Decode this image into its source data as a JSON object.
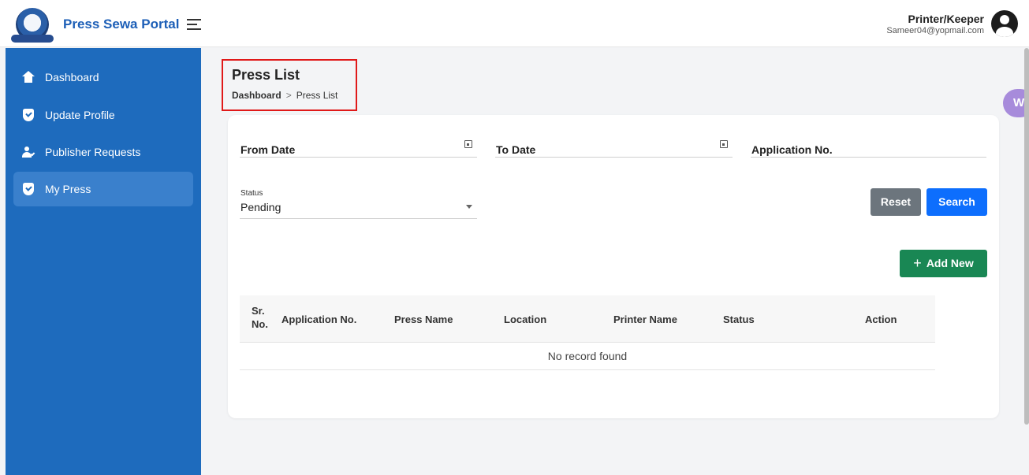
{
  "header": {
    "brand": "Press Sewa Portal",
    "user_role": "Printer/Keeper",
    "user_email": "Sameer04@yopmail.com"
  },
  "sidebar": {
    "items": [
      {
        "label": "Dashboard",
        "icon": "home-icon"
      },
      {
        "label": "Update Profile",
        "icon": "shield-check-icon"
      },
      {
        "label": "Publisher Requests",
        "icon": "user-check-icon"
      },
      {
        "label": "My Press",
        "icon": "shield-check-icon",
        "active": true
      }
    ]
  },
  "page": {
    "title": "Press List",
    "breadcrumb": {
      "home": "Dashboard",
      "separator": ">",
      "current": "Press List"
    }
  },
  "filters": {
    "from_date_label": "From Date",
    "to_date_label": "To Date",
    "application_no_label": "Application No.",
    "status_label": "Status",
    "status_value": "Pending"
  },
  "buttons": {
    "reset": "Reset",
    "search": "Search",
    "add_new": "Add New"
  },
  "table": {
    "columns": [
      "Sr. No.",
      "Application No.",
      "Press Name",
      "Location",
      "Printer Name",
      "Status",
      "Action"
    ],
    "sr_line1": "Sr.",
    "sr_line2": "No.",
    "empty_message": "No record found"
  },
  "widget": {
    "letter": "W"
  },
  "colors": {
    "sidebar": "#1e6bbd",
    "brand": "#1d5fb7",
    "search_button": "#0d6efd",
    "reset_button": "#6c757d",
    "add_button": "#198754",
    "highlight_border": "#e01919"
  }
}
